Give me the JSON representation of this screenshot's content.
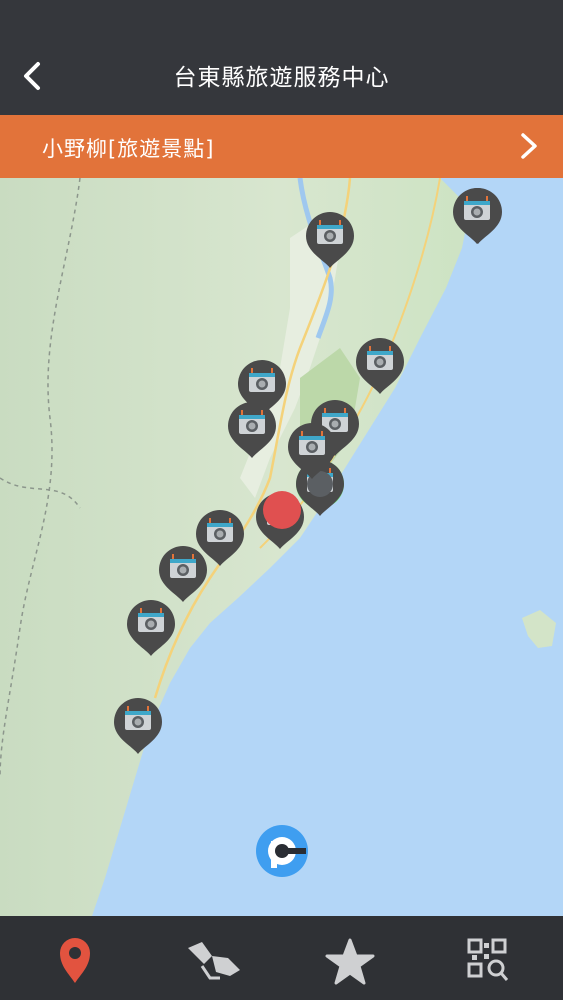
{
  "header": {
    "title": "台東縣旅遊服務中心"
  },
  "banner": {
    "label": "小野柳[旅遊景點]"
  },
  "map": {
    "pins": [
      {
        "name": "attraction-pin-1",
        "state": "default"
      },
      {
        "name": "attraction-pin-2",
        "state": "default"
      },
      {
        "name": "attraction-pin-3",
        "state": "default"
      },
      {
        "name": "attraction-pin-4",
        "state": "default"
      },
      {
        "name": "attraction-pin-5",
        "state": "default"
      },
      {
        "name": "attraction-pin-6",
        "state": "default"
      },
      {
        "name": "attraction-pin-7",
        "state": "default"
      },
      {
        "name": "attraction-pin-8",
        "state": "selected"
      },
      {
        "name": "attraction-pin-9",
        "state": "default"
      },
      {
        "name": "attraction-pin-10",
        "state": "default"
      },
      {
        "name": "attraction-pin-11",
        "state": "default"
      },
      {
        "name": "attraction-pin-12",
        "state": "default"
      },
      {
        "name": "attraction-pin-13",
        "state": "default"
      },
      {
        "name": "attraction-pin-14",
        "state": "default"
      }
    ],
    "current_location_color": "#e05050",
    "selected_color": "#6fe36f",
    "pin_color": "#4a4a4a"
  },
  "tabs": [
    {
      "name": "tab-map",
      "icon": "map-pin-icon",
      "active": true
    },
    {
      "name": "tab-route",
      "icon": "footprints-icon",
      "active": false
    },
    {
      "name": "tab-favorites",
      "icon": "star-icon",
      "active": false
    },
    {
      "name": "tab-scan",
      "icon": "qr-scan-icon",
      "active": false
    }
  ],
  "colors": {
    "accent": "#e2733a",
    "header": "#35373c",
    "active_tab": "#e2533f"
  }
}
